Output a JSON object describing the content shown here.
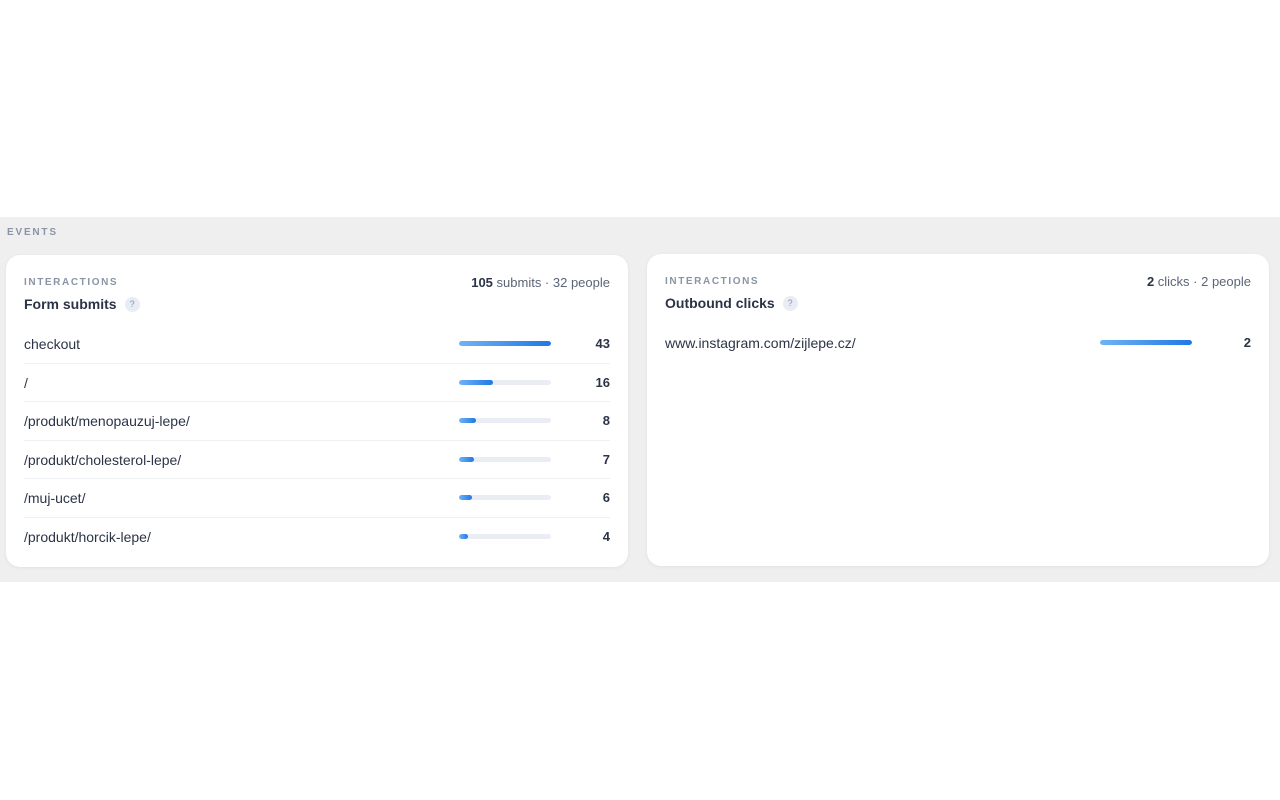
{
  "section": {
    "label": "EVENTS"
  },
  "form_submits": {
    "kicker": "INTERACTIONS",
    "title": "Form submits",
    "help": "?",
    "summary_count": "105",
    "summary_rest": " submits · 32 people",
    "rows": [
      {
        "label": "checkout",
        "value": "43",
        "fraction": 1.0
      },
      {
        "label": "/",
        "value": "16",
        "fraction": 0.37
      },
      {
        "label": "/produkt/menopauzuj-lepe/",
        "value": "8",
        "fraction": 0.186
      },
      {
        "label": "/produkt/cholesterol-lepe/",
        "value": "7",
        "fraction": 0.163
      },
      {
        "label": "/muj-ucet/",
        "value": "6",
        "fraction": 0.14
      },
      {
        "label": "/produkt/horcik-lepe/",
        "value": "4",
        "fraction": 0.093
      }
    ]
  },
  "outbound_clicks": {
    "kicker": "INTERACTIONS",
    "title": "Outbound clicks",
    "help": "?",
    "summary_count": "2",
    "summary_rest": " clicks · 2 people",
    "rows": [
      {
        "label": "www.instagram.com/zijlepe.cz/",
        "value": "2",
        "fraction": 1.0
      }
    ]
  },
  "colors": {
    "bar_start": "#6fb3f5",
    "bar_end": "#1f78e6",
    "band_background": "#efefef"
  }
}
